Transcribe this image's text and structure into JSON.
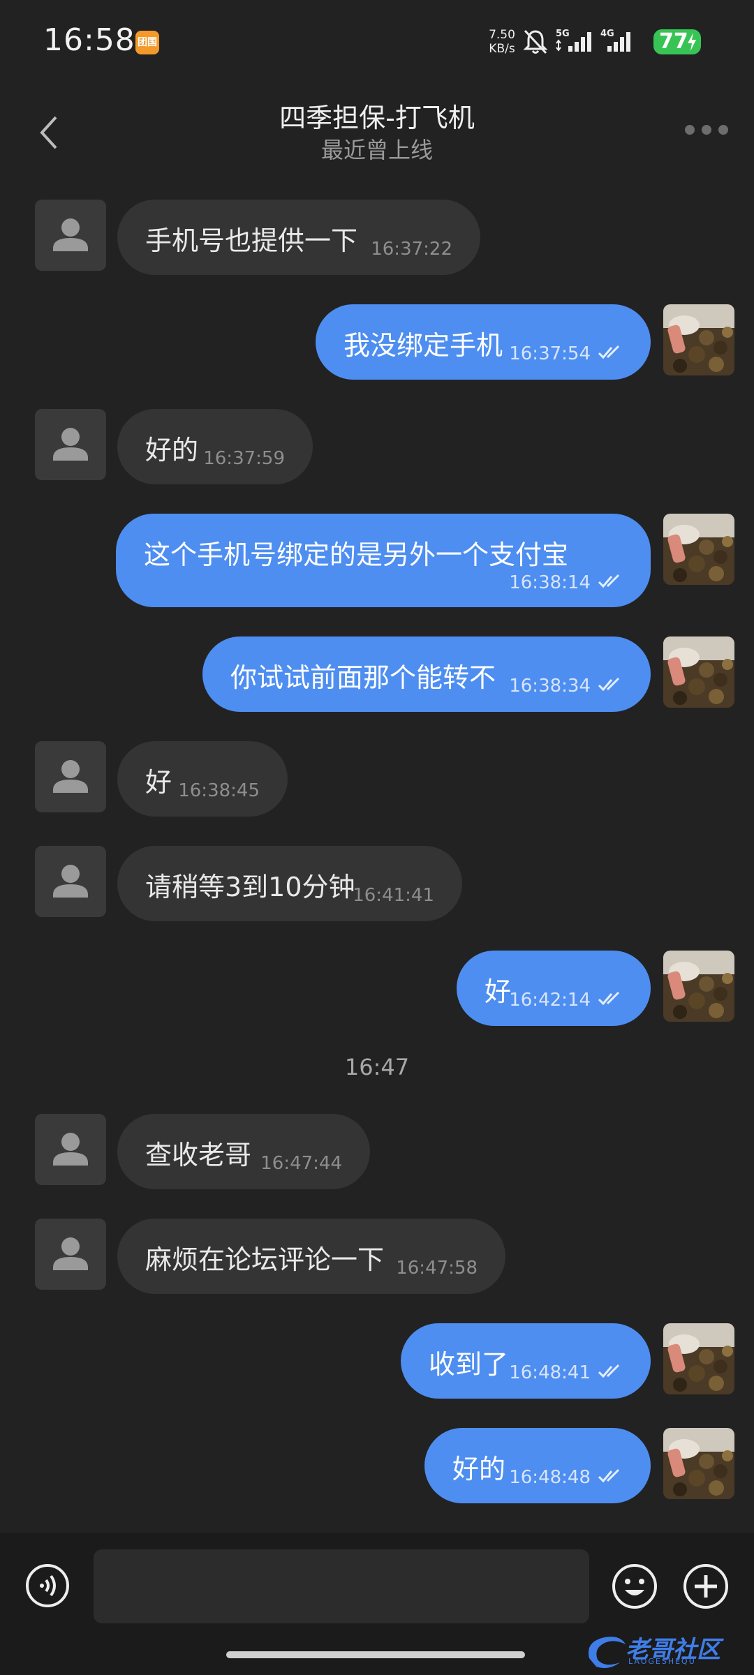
{
  "status_bar": {
    "time": "16:58",
    "app_badge": "团国",
    "net_speed_value": "7.50",
    "net_speed_unit": "KB/s",
    "signal1_label": "5G",
    "signal2_label": "4G",
    "battery": "77"
  },
  "header": {
    "title": "四季担保-打飞机",
    "subtitle": "最近曾上线"
  },
  "messages": [
    {
      "dir": "in",
      "text": "手机号也提供一下",
      "time": "16:37:22"
    },
    {
      "dir": "out",
      "text": "我没绑定手机",
      "time": "16:37:54"
    },
    {
      "dir": "in",
      "text": "好的",
      "time": "16:37:59"
    },
    {
      "dir": "out",
      "text": "这个手机号绑定的是另外一个支付宝",
      "time": "16:38:14"
    },
    {
      "dir": "out",
      "text": "你试试前面那个能转不",
      "time": "16:38:34"
    },
    {
      "dir": "in",
      "text": "好",
      "time": "16:38:45"
    },
    {
      "dir": "in",
      "text": "请稍等3到10分钟",
      "time": "16:41:41"
    },
    {
      "dir": "out",
      "text": "好",
      "time": "16:42:14"
    },
    {
      "dir": "divider",
      "text": "16:47"
    },
    {
      "dir": "in",
      "text": "查收老哥",
      "time": "16:47:44"
    },
    {
      "dir": "in",
      "text": "麻烦在论坛评论一下",
      "time": "16:47:58"
    },
    {
      "dir": "out",
      "text": "收到了",
      "time": "16:48:41"
    },
    {
      "dir": "out",
      "text": "好的",
      "time": "16:48:48"
    }
  ],
  "input": {
    "placeholder": ""
  },
  "watermark": {
    "text": "老哥社区",
    "sub": "LAOGESHEQU"
  },
  "colors": {
    "background": "#222223",
    "incoming_bubble": "#343435",
    "outgoing_bubble": "#4e8ef1",
    "battery": "#38c455"
  }
}
